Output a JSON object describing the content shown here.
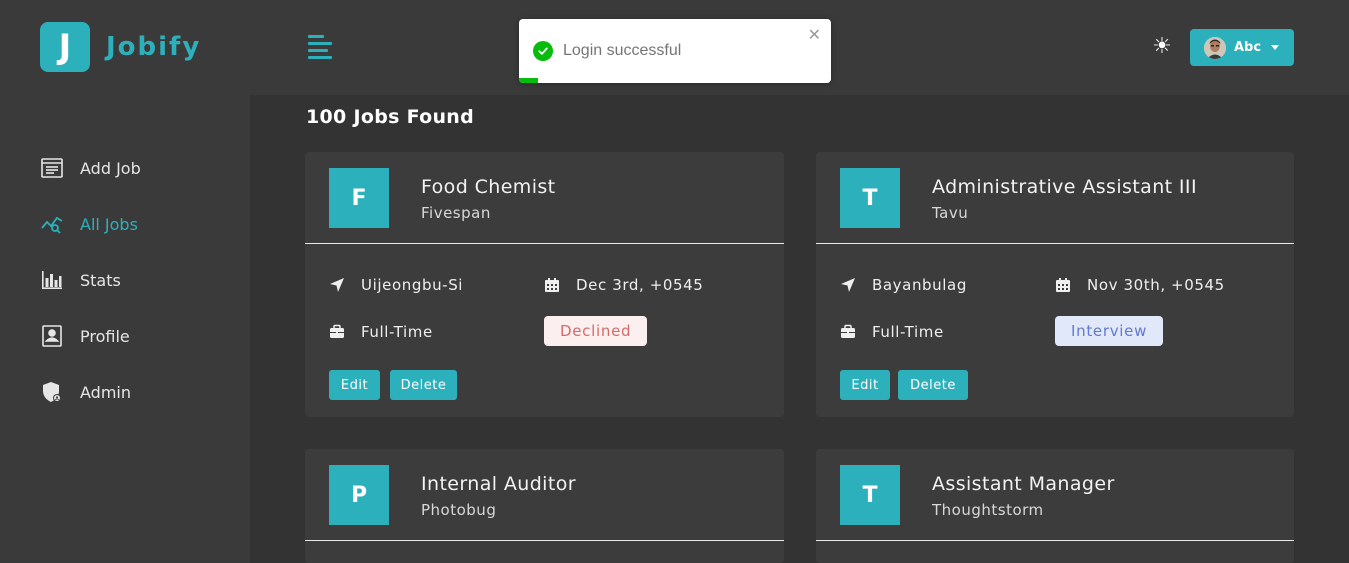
{
  "app": {
    "logo_letter": "J",
    "name": "Jobify"
  },
  "sidebar": {
    "items": [
      {
        "label": "Add Job",
        "icon": "add-job-icon",
        "active": false
      },
      {
        "label": "All Jobs",
        "icon": "all-jobs-icon",
        "active": true
      },
      {
        "label": "Stats",
        "icon": "stats-icon",
        "active": false
      },
      {
        "label": "Profile",
        "icon": "profile-icon",
        "active": false
      },
      {
        "label": "Admin",
        "icon": "admin-icon",
        "active": false
      }
    ]
  },
  "header": {
    "theme_icon": "☀",
    "user": {
      "name": "Abc"
    }
  },
  "toast": {
    "message": "Login successful",
    "close": "✕",
    "progress": 0.06
  },
  "jobs": {
    "count_text": "100 Jobs Found",
    "items": [
      {
        "letter": "F",
        "position": "Food Chemist",
        "company": "Fivespan",
        "location": "Uijeongbu-Si",
        "date": "Dec 3rd, +0545",
        "type": "Full-Time",
        "status": "Declined",
        "status_bg": "#fcefef",
        "status_color": "#d66a6a",
        "edit": "Edit",
        "delete": "Delete"
      },
      {
        "letter": "T",
        "position": "Administrative Assistant III",
        "company": "Tavu",
        "location": "Bayanbulag",
        "date": "Nov 30th, +0545",
        "type": "Full-Time",
        "status": "Interview",
        "status_bg": "#e0e8f9",
        "status_color": "#647acb",
        "edit": "Edit",
        "delete": "Delete"
      },
      {
        "letter": "P",
        "position": "Internal Auditor",
        "company": "Photobug"
      },
      {
        "letter": "T",
        "position": "Assistant Manager",
        "company": "Thoughtstorm"
      }
    ]
  },
  "colors": {
    "primary": "#2cb1bc",
    "background": "#333333",
    "card": "#3c3c3c",
    "success": "#07bc0c"
  }
}
